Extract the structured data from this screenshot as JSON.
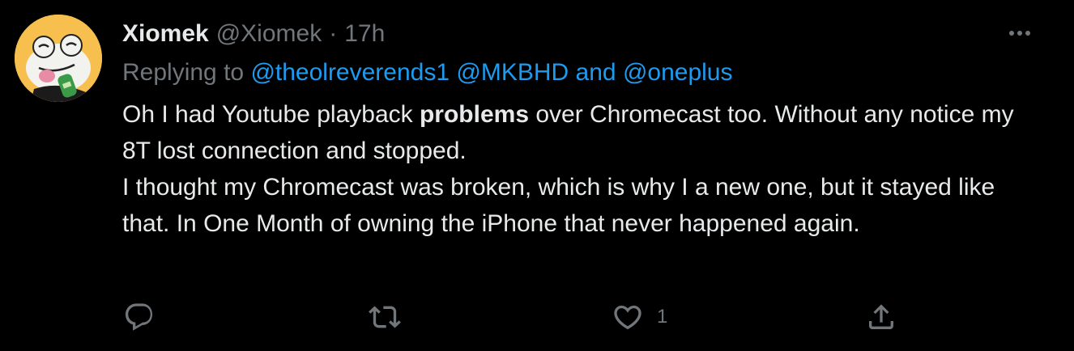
{
  "author": {
    "name": "Xiomek",
    "handle": "@Xiomek",
    "separator": "·",
    "time": "17h",
    "avatar_icon": "frog-avatar"
  },
  "reply": {
    "prefix": "Replying to",
    "mention1": "@theolreverends1",
    "mention2": "@MKBHD",
    "conjunction": "and",
    "mention3": "@oneplus"
  },
  "tweet": {
    "p1_before": "Oh I had Youtube playback ",
    "p1_bold": "problems",
    "p1_after": " over Chromecast too. Without any notice my 8T lost connection and stopped.",
    "p2": "I thought my Chromecast was broken, which is why I a new one, but it stayed like that. In One Month of owning the iPhone that never happened again."
  },
  "actions": {
    "reply_icon": "reply-icon",
    "retweet_icon": "retweet-icon",
    "like_icon": "heart-icon",
    "like_count": "1",
    "share_icon": "share-icon"
  },
  "colors": {
    "background": "#000000",
    "text": "#e7e9ea",
    "muted": "#71767b",
    "link": "#1d9bf0"
  }
}
